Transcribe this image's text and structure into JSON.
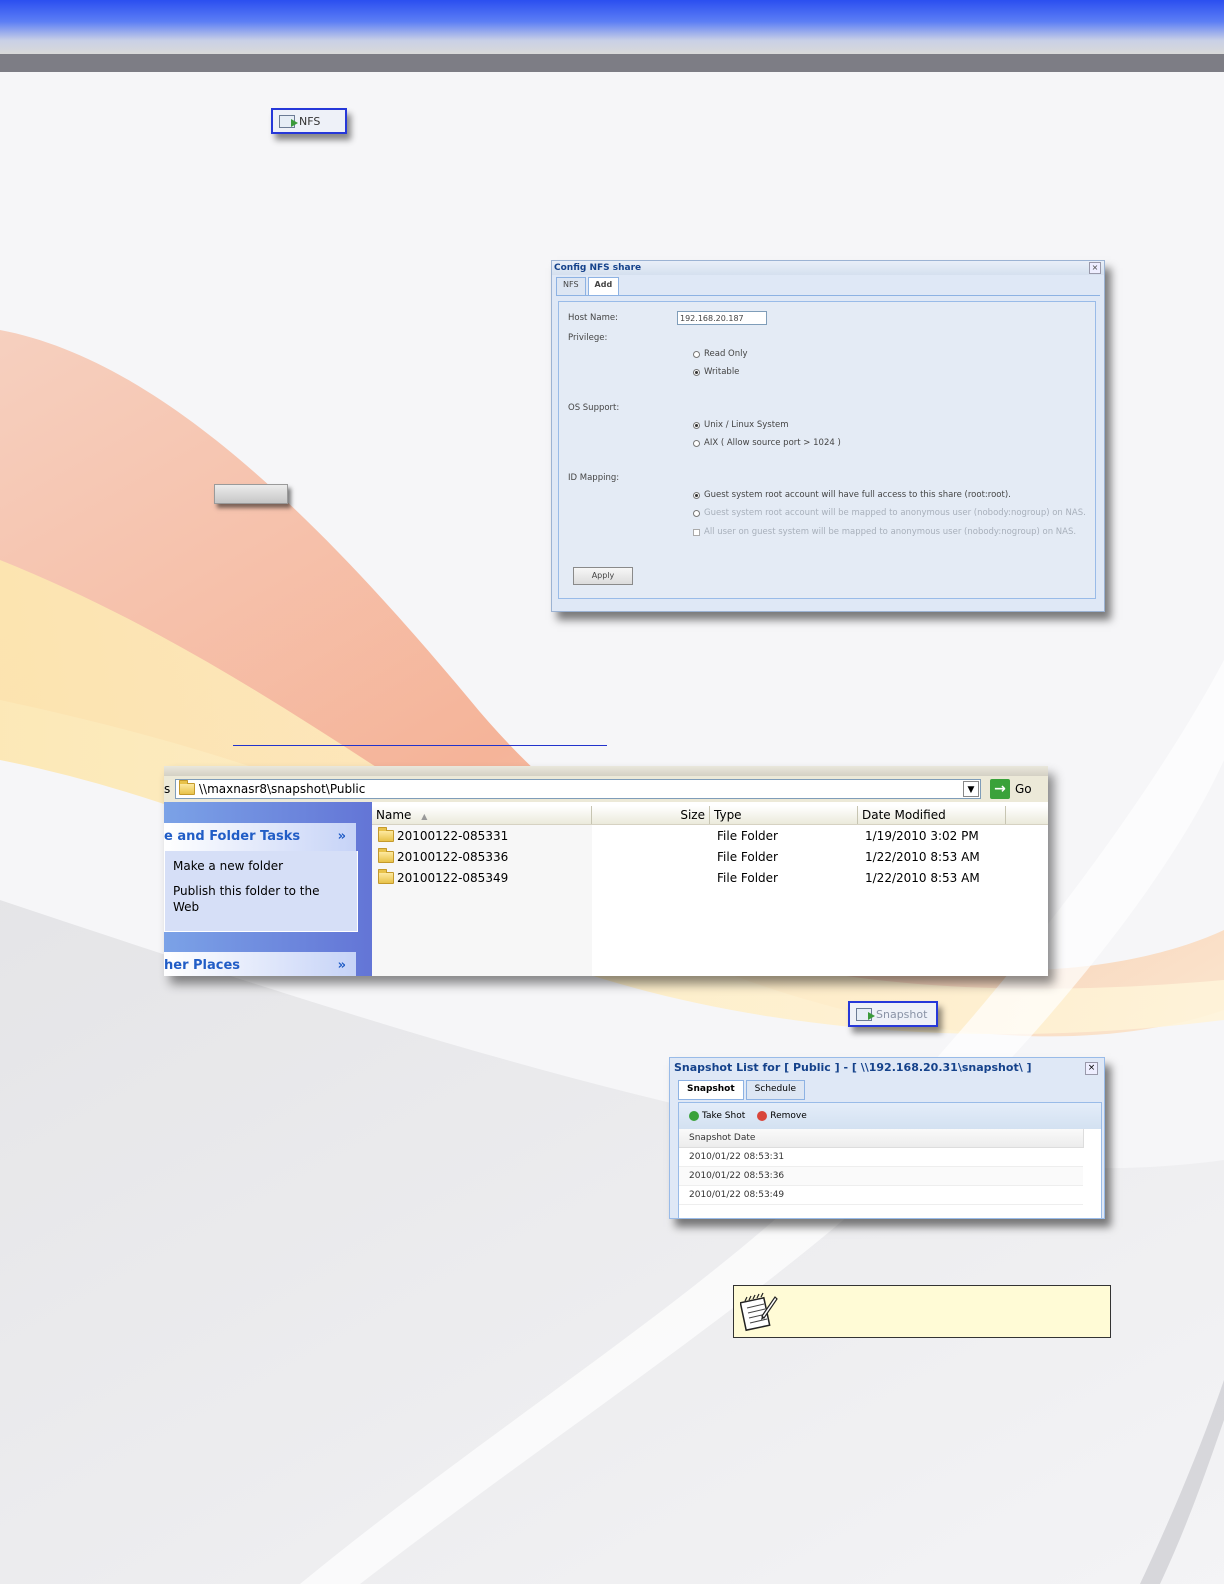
{
  "toolbar_buttons": {
    "nfs_label": "NFS",
    "snapshot_label": "Snapshot"
  },
  "nfs_dialog": {
    "title": "Config NFS share",
    "close": "×",
    "tabs": [
      "NFS",
      "Add"
    ],
    "active_tab": "Add",
    "host_name_label": "Host Name:",
    "host_name_value": "192.168.20.187",
    "privilege_label": "Privilege:",
    "privilege_options": [
      "Read Only",
      "Writable"
    ],
    "privilege_selected": "Writable",
    "os_support_label": "OS Support:",
    "os_support_options": [
      "Unix / Linux System",
      "AIX ( Allow source port > 1024 )"
    ],
    "os_support_selected": "Unix / Linux System",
    "id_mapping_label": "ID Mapping:",
    "id_mapping_options": [
      "Guest system root account will have full access to this share (root:root).",
      "Guest system root account will be mapped to anonymous user (nobody:nogroup) on NAS.",
      "All user on guest system will be mapped to anonymous user (nobody:nogroup) on NAS."
    ],
    "apply_label": "Apply"
  },
  "explorer": {
    "address_label": "s",
    "address_path": "\\\\maxnasr8\\snapshot\\Public",
    "dropdown_glyph": "▼",
    "go_label": "Go",
    "go_arrow": "→",
    "left_panel": {
      "file_tasks_heading": "e and Folder Tasks",
      "chevron": "»",
      "tasks": [
        "Make a new folder",
        "Publish this folder to the Web"
      ],
      "other_places_heading": "her Places"
    },
    "columns": [
      "Name",
      "Size",
      "Type",
      "Date Modified"
    ],
    "sort_indicator": "▲",
    "rows": [
      {
        "name": "20100122-085331",
        "size": "",
        "type": "File Folder",
        "date": "1/19/2010 3:02 PM"
      },
      {
        "name": "20100122-085336",
        "size": "",
        "type": "File Folder",
        "date": "1/22/2010 8:53 AM"
      },
      {
        "name": "20100122-085349",
        "size": "",
        "type": "File Folder",
        "date": "1/22/2010 8:53 AM"
      }
    ]
  },
  "snapshot_dialog": {
    "title": "Snapshot List for [ Public ] - [ \\\\192.168.20.31\\snapshot\\ ]",
    "close": "×",
    "tabs": [
      "Snapshot",
      "Schedule"
    ],
    "active_tab": "Snapshot",
    "take_shot_label": "Take Shot",
    "remove_label": "Remove",
    "column_header": "Snapshot Date",
    "rows": [
      "2010/01/22 08:53:31",
      "2010/01/22 08:53:36",
      "2010/01/22 08:53:49"
    ]
  },
  "colors": {
    "header_blue": "#2b4ff0",
    "button_border": "#2638d9",
    "note_background": "#fffbd6"
  }
}
